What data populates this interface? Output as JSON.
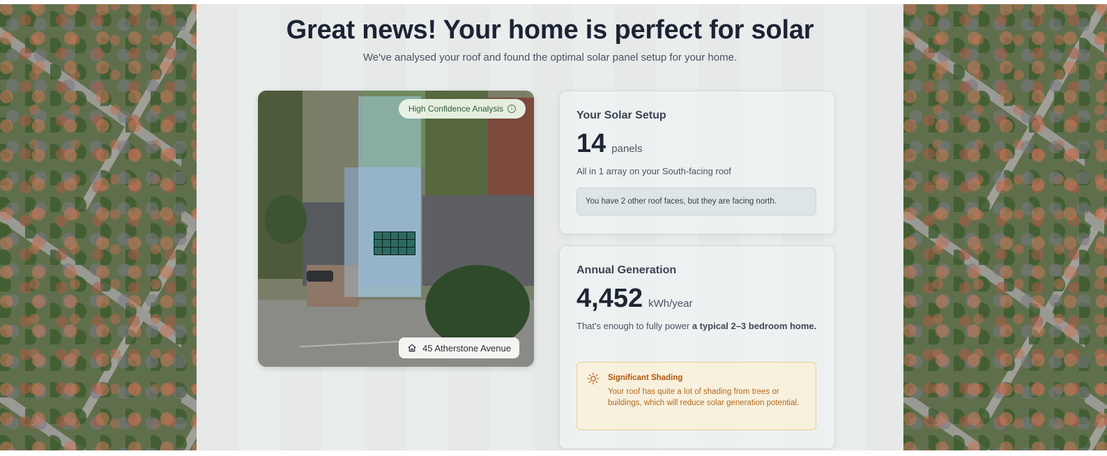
{
  "hero": {
    "title": "Great news! Your home is perfect for solar",
    "subtitle": "We've analysed your roof and found the optimal solar panel setup for your home."
  },
  "roof_view": {
    "confidence_badge": "High Confidence Analysis",
    "address": "45 Atherstone Avenue",
    "icons": {
      "confidence": "info-icon",
      "address": "home-icon"
    }
  },
  "setup_card": {
    "title": "Your Solar Setup",
    "value": "14",
    "unit": "panels",
    "description": "All in 1 array on your South-facing roof",
    "note": "You have 2 other roof faces, but they are facing north."
  },
  "generation_card": {
    "title": "Annual Generation",
    "value": "4,452",
    "unit": "kWh/year",
    "description_prefix": "That's enough to fully power",
    "description_bold": "a typical 2–3 bedroom home.",
    "warning": {
      "title": "Significant Shading",
      "body": "Your roof has quite a lot of shading from trees or buildings, which will reduce solar generation potential.",
      "icon": "sun-icon",
      "color": "#b0570d"
    }
  },
  "colors": {
    "heading": "#1c2333",
    "card_bg": "#eef2f1",
    "warning_border": "#e9d08c",
    "panel": "#2c6b62"
  }
}
